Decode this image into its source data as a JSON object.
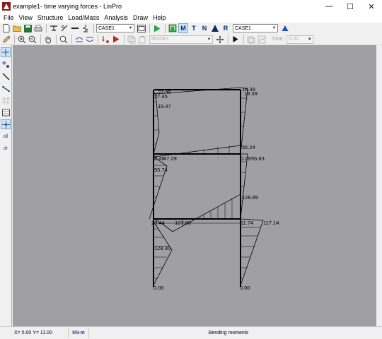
{
  "window": {
    "title": "example1- time varying forces - LinPro",
    "controls": {
      "minimize": "—",
      "maximize": "☐",
      "close": "✕"
    }
  },
  "menu": [
    "File",
    "View",
    "Structure",
    "Load/Mass",
    "Analysis",
    "Draw",
    "Help"
  ],
  "toolbar1": {
    "load_case_combo": "CASE1",
    "result_case_combo": "CASE1",
    "result_buttons": [
      "M",
      "T",
      "N",
      "R"
    ]
  },
  "toolbar2": {
    "mode_combo": "MODE1",
    "time_label": "Time:",
    "time_value": "0.00"
  },
  "left_tools": [
    "all",
    "dr"
  ],
  "diagram": {
    "labels": [
      "19.39",
      "19.39",
      "27.45",
      "27.45",
      "19.47",
      "55.24",
      "8.49",
      "47.29",
      "55.74",
      "0.29",
      "55.63",
      "128.89",
      "20.44",
      "107.86",
      "11.74",
      "117.14",
      "128.30",
      "0.00",
      "0.00"
    ]
  },
  "status": {
    "coords": "X= 5.00  Y= 11.00",
    "units": "kN-m",
    "message": "Bending moments"
  },
  "colors": {
    "canvas": "#a0a0a4",
    "units_text": "#1f3fa0"
  }
}
